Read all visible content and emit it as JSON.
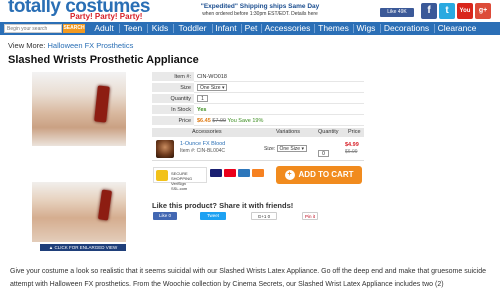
{
  "header": {
    "logo": "totally costumes",
    "logo_sub": "Party! Party! Party!",
    "shipping_line1": "\"Expedited\" Shipping ships Same Day",
    "shipping_line2": "when ordered before 1:30pm EST/EDT. Details here",
    "fb_like": "Like 49K",
    "social": [
      "facebook-icon",
      "twitter-icon",
      "youtube-icon",
      "google-plus-icon"
    ],
    "youtube_label": "You",
    "gplus_label": "g+"
  },
  "nav": {
    "search_placeholder": "Begin your search",
    "search_button": "SEARCH",
    "items": [
      "Adult",
      "Teen",
      "Kids",
      "Toddler",
      "Infant",
      "Pet",
      "Accessories",
      "Themes",
      "Wigs",
      "Decorations",
      "Clearance"
    ]
  },
  "breadcrumb": {
    "prefix": "View More:",
    "link": "Halloween FX Prosthetics"
  },
  "product": {
    "title": "Slashed Wrists Prosthetic Appliance",
    "enlarge": "▲ CLICK FOR ENLARGED VIEW",
    "fields": {
      "item_label": "Item #:",
      "item_value": "CIN-WO018",
      "size_label": "Size",
      "size_value": "One Size ▾",
      "quantity_label": "Quantity",
      "quantity_value": "1",
      "stock_label": "In Stock",
      "stock_value": "Yes",
      "price_label": "Price",
      "price_value": "$6.45",
      "price_old": "$7.99",
      "price_save": "You Save 19%"
    }
  },
  "accessories": {
    "headers": [
      "Accessories",
      "Variations",
      "Quantity",
      "Price"
    ],
    "item_name": "1-Ounce FX Blood",
    "item_number": "Item #: CIN-BL004C",
    "size_label": "Size:",
    "size_value": "One Size ▾",
    "qty": "0",
    "price": "$4.99",
    "price_old": "$6.99"
  },
  "secure": {
    "line1": "SECURE SHOPPING",
    "line2": "VeriSign SSL.com"
  },
  "add_to_cart": "ADD TO CART",
  "share": {
    "title": "Like this product? Share it with friends!",
    "fb": "Like 0",
    "tw": "Tweet",
    "gp": "G+1  0",
    "pin": "Pin it"
  },
  "description": "Give your costume a look so realistic that it seems suicidal with our Slashed Wrists Latex Appliance. Go off the deep end and make that gruesome suicide attempt with Halloween FX prosthetics. From the Woochie collection by Cinema Secrets, our Slashed Wrist Latex Appliance includes two (2)",
  "colors": {
    "brand_blue": "#2b6fb6",
    "orange": "#f18b1e",
    "red": "#d71e26"
  }
}
